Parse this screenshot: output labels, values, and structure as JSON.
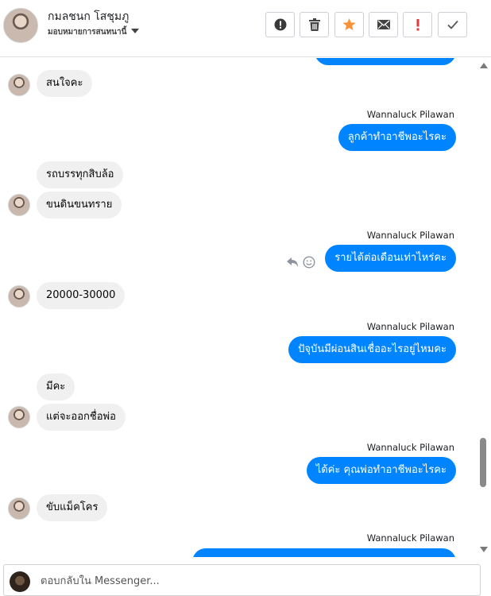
{
  "header": {
    "contact_name": "กมลชนก โสชุมภู",
    "subtitle": "มอบหมายการสนทนานี้",
    "actions": [
      {
        "name": "mark-spam-button",
        "icon": "alert-circle-icon"
      },
      {
        "name": "delete-button",
        "icon": "trash-icon"
      },
      {
        "name": "star-button",
        "icon": "star-icon",
        "color": "#f7923a"
      },
      {
        "name": "mark-unread-button",
        "icon": "envelope-icon"
      },
      {
        "name": "follow-up-button",
        "icon": "exclamation-icon",
        "color": "#e0393e"
      },
      {
        "name": "mark-done-button",
        "icon": "check-icon"
      }
    ]
  },
  "messages": {
    "m1": "สนใจคะ",
    "s1": "Wannaluck Pilawan",
    "m2": "ลูกค้าทำอาชีพอะไรคะ",
    "m3": "รถบรรทุกสิบล้อ",
    "m4": "ขนดินขนทราย",
    "s2": "Wannaluck Pilawan",
    "m5": "รายได้ต่อเดือนเท่าไหร่คะ",
    "m6": "20000-30000",
    "s3": "Wannaluck Pilawan",
    "m7": "ปัจุบันมีผ่อนสินเชื่ออะไรอยู่ไหมคะ",
    "m8": "มีคะ",
    "m9": "แต่จะออกชื่อพ่อ",
    "s4": "Wannaluck Pilawan",
    "m10": "ได้ค่ะ  คุณพ่อทำอาชีพอะไรคะ",
    "m11": "ขับแม็คโคร",
    "s5": "Wannaluck Pilawan"
  },
  "composer": {
    "placeholder": "ตอบกลับใน Messenger..."
  },
  "colors": {
    "outgoing_bubble": "#0084ff",
    "incoming_bubble": "#f0f0f0"
  }
}
